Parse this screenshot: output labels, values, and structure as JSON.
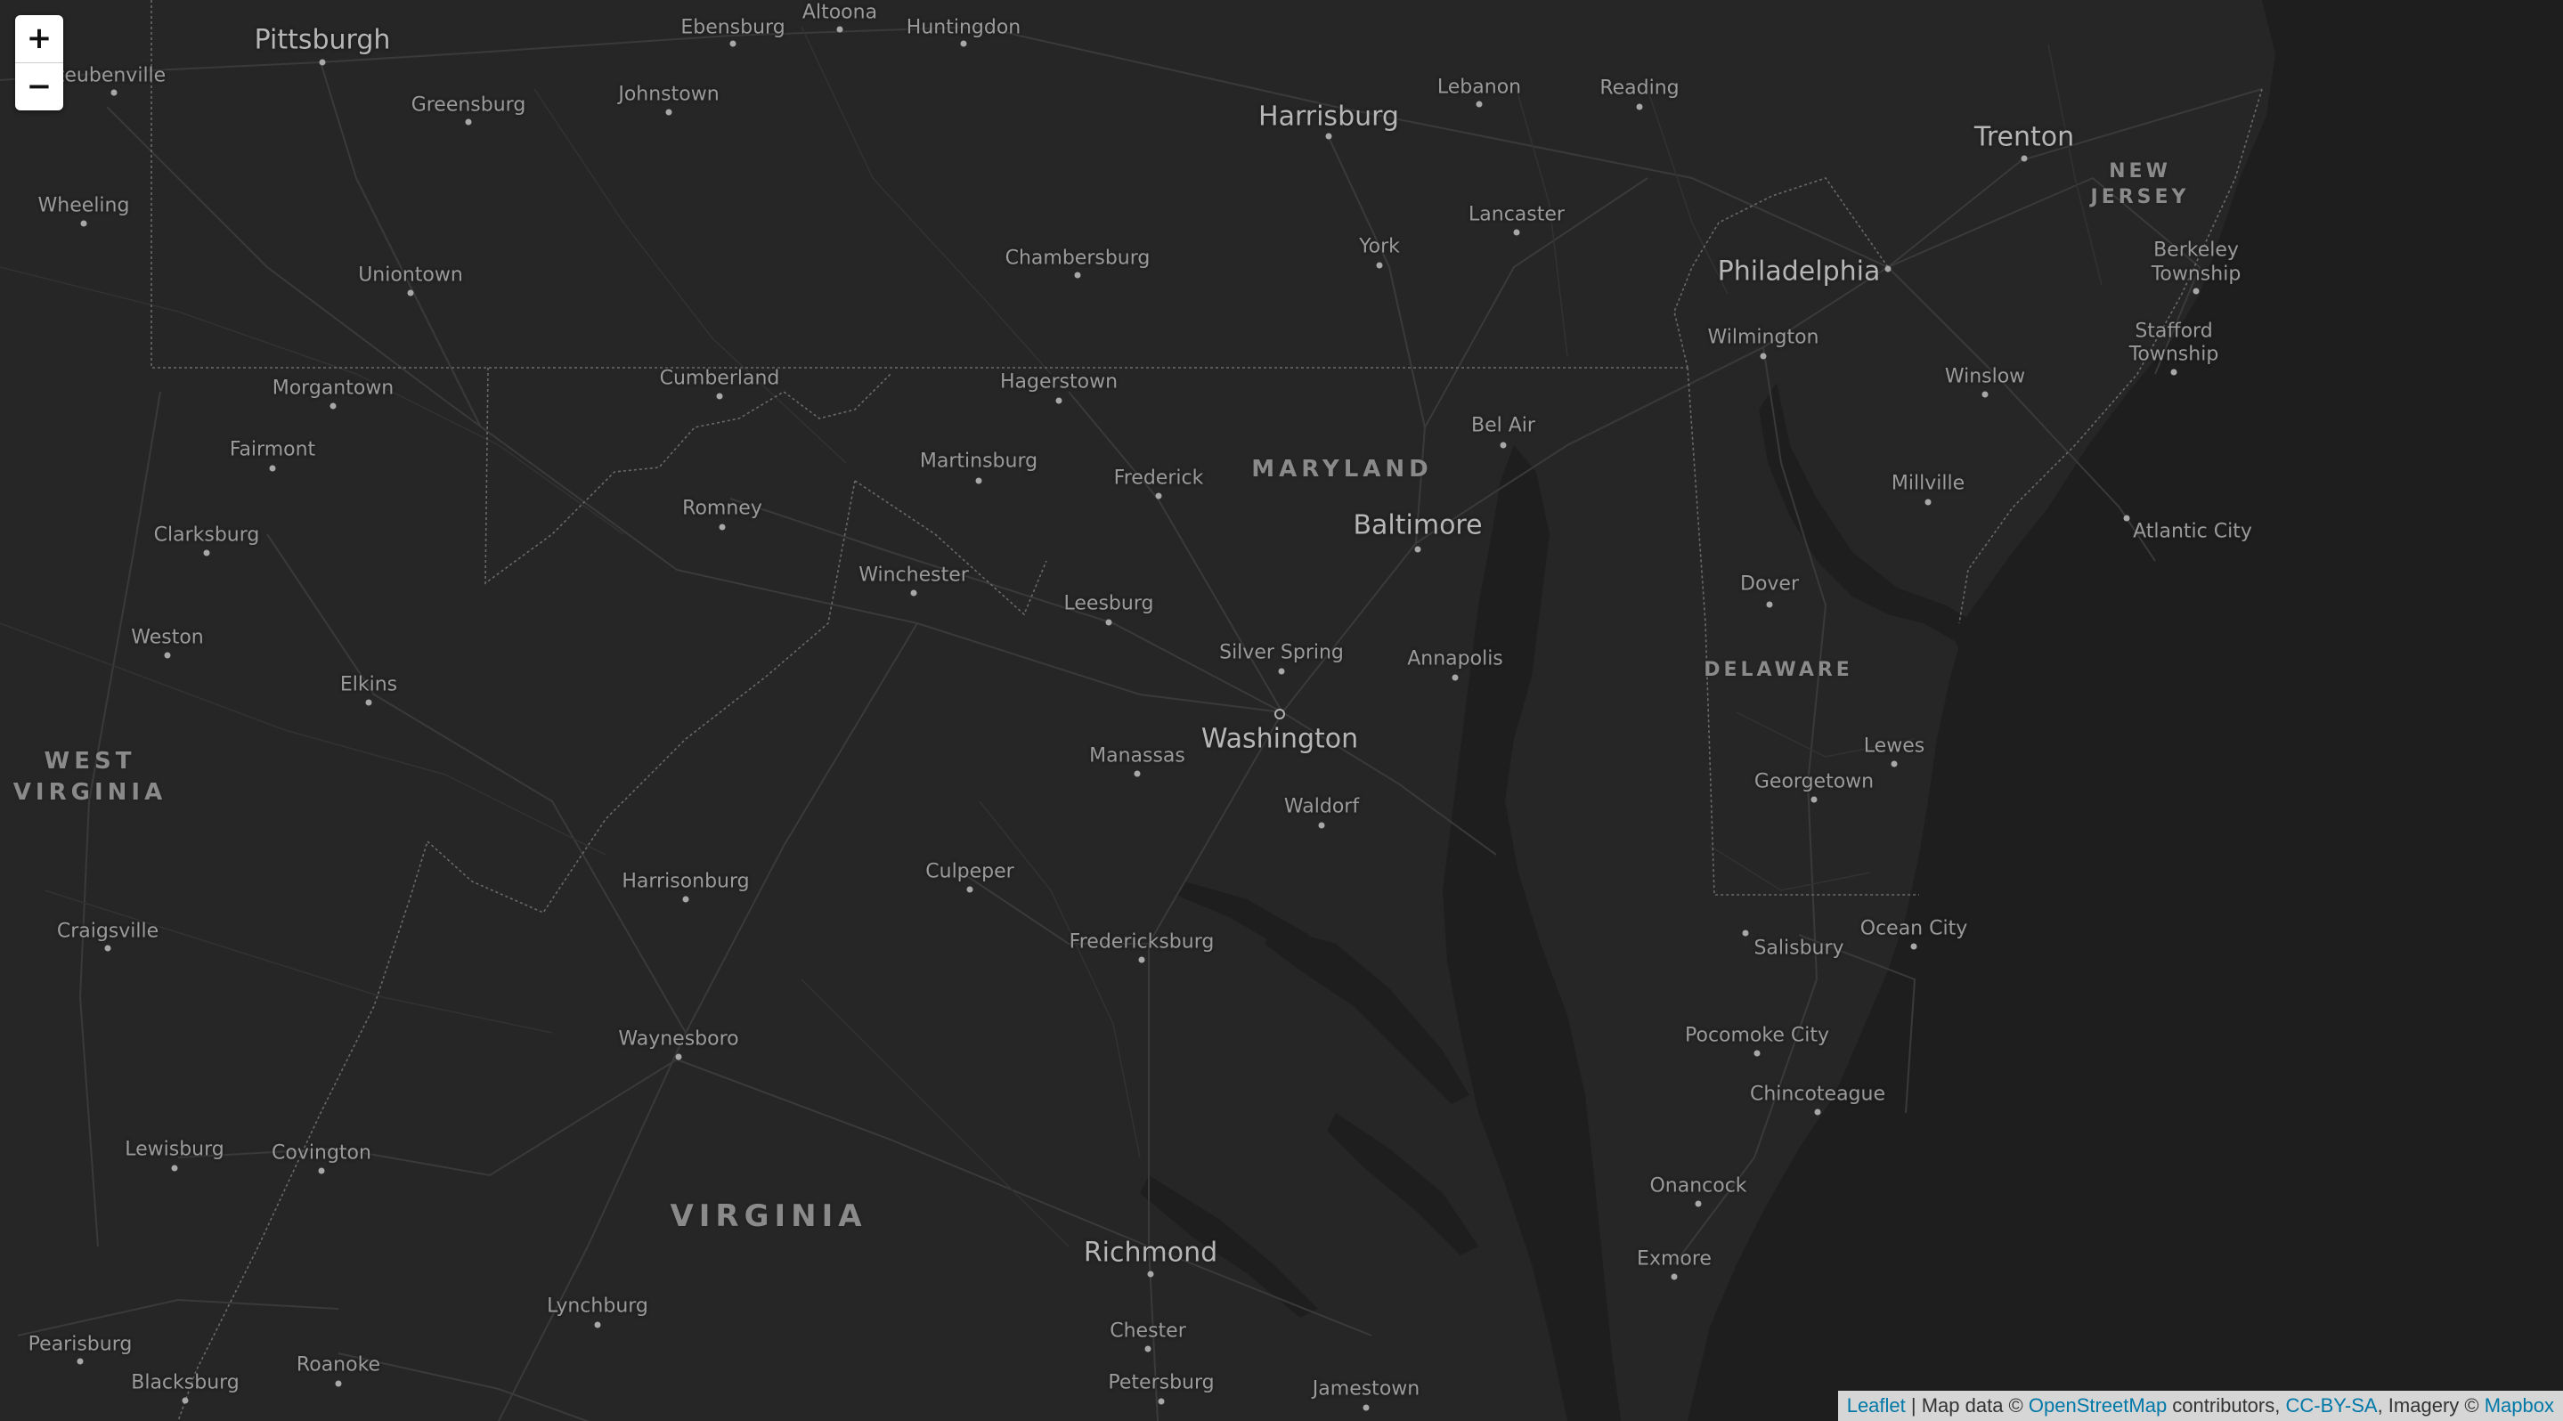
{
  "map": {
    "colors": {
      "land": "#262627",
      "water": "#1e1e1f",
      "roads": "#3b3b3c",
      "border": "#6a6a6a",
      "label": "#9a9a9a"
    },
    "zoom_control": {
      "zoom_in_label": "+",
      "zoom_out_label": "−"
    },
    "attribution": {
      "leaflet": "Leaflet",
      "sep1": " | Map data © ",
      "osm": "OpenStreetMap",
      "sep2": " contributors, ",
      "license": "CC-BY-SA",
      "sep3": ", Imagery © ",
      "mapbox": "Mapbox"
    },
    "states": {
      "maryland": "MARYLAND",
      "delaware": "DELAWARE",
      "new_jersey_1": "NEW",
      "new_jersey_2": "JERSEY",
      "west_virginia_1": "WEST",
      "west_virginia_2": "VIRGINIA",
      "virginia": "VIRGINIA"
    },
    "cities": {
      "pittsburgh": "Pittsburgh",
      "steubenville": "Steubenville",
      "ebensburg": "Ebensburg",
      "altoona": "Altoona",
      "huntingdon": "Huntingdon",
      "johnstown": "Johnstown",
      "greensburg": "Greensburg",
      "wheeling": "Wheeling",
      "uniontown": "Uniontown",
      "morgantown": "Morgantown",
      "fairmont": "Fairmont",
      "clarksburg": "Clarksburg",
      "weston": "Weston",
      "elkins": "Elkins",
      "craigsville": "Craigsville",
      "lewisburg": "Lewisburg",
      "covington": "Covington",
      "pearisburg": "Pearisburg",
      "blacksburg": "Blacksburg",
      "roanoke": "Roanoke",
      "lynchburg": "Lynchburg",
      "harrisburg": "Harrisburg",
      "lebanon": "Lebanon",
      "reading": "Reading",
      "lancaster": "Lancaster",
      "york": "York",
      "chambersburg": "Chambersburg",
      "cumberland": "Cumberland",
      "hagerstown": "Hagerstown",
      "martinsburg": "Martinsburg",
      "frederick": "Frederick",
      "romney": "Romney",
      "winchester": "Winchester",
      "leesburg": "Leesburg",
      "bel_air": "Bel Air",
      "baltimore": "Baltimore",
      "silver_spring": "Silver Spring",
      "annapolis": "Annapolis",
      "washington": "Washington",
      "manassas": "Manassas",
      "waldorf": "Waldorf",
      "harrisonburg": "Harrisonburg",
      "culpeper": "Culpeper",
      "fredericksburg": "Fredericksburg",
      "waynesboro": "Waynesboro",
      "richmond": "Richmond",
      "chester": "Chester",
      "petersburg": "Petersburg",
      "jamestown": "Jamestown",
      "trenton": "Trenton",
      "philadelphia": "Philadelphia",
      "wilmington": "Wilmington",
      "berkeley_1": "Berkeley",
      "berkeley_2": "Township",
      "stafford_1": "Stafford",
      "stafford_2": "Township",
      "winslow": "Winslow",
      "millville": "Millville",
      "atlantic_city": "Atlantic City",
      "dover": "Dover",
      "lewes": "Lewes",
      "georgetown": "Georgetown",
      "salisbury": "Salisbury",
      "ocean_city": "Ocean City",
      "pocomoke_city": "Pocomoke City",
      "chincoteague": "Chincoteague",
      "onancock": "Onancock",
      "exmore": "Exmore"
    }
  }
}
